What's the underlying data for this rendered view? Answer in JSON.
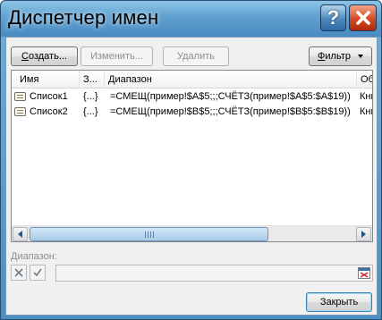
{
  "window": {
    "title": "Диспетчер имен"
  },
  "toolbar": {
    "create_label_underlined": "С",
    "create_label_rest": "оздать...",
    "edit_label": "Изменить...",
    "delete_label": "Удалить",
    "filter_label_underlined": "Ф",
    "filter_label_rest": "ильтр"
  },
  "table": {
    "columns": [
      "Имя",
      "З...",
      "Диапазон",
      "Об..."
    ],
    "rows": [
      {
        "name": "Список1",
        "value": "{...}",
        "range": "=СМЕЩ(пример!$A$5;;;СЧЁТЗ(пример!$A$5:$A$19))",
        "scope": "Кни..."
      },
      {
        "name": "Список2",
        "value": "{...}",
        "range": "=СМЕЩ(пример!$B$5;;;СЧЁТЗ(пример!$B$5:$B$19))",
        "scope": "Кни..."
      }
    ]
  },
  "range_section": {
    "label": "Диапазон:",
    "value": ""
  },
  "footer": {
    "close_label": "Закрыть"
  },
  "colors": {
    "title_bar": "#5fa0cf",
    "close_button": "#d34b25",
    "dialog_bg": "#f0f0f0"
  },
  "icons": [
    "help-icon",
    "close-icon",
    "name-icon",
    "cancel-x-icon",
    "confirm-check-icon",
    "range-select-icon"
  ]
}
